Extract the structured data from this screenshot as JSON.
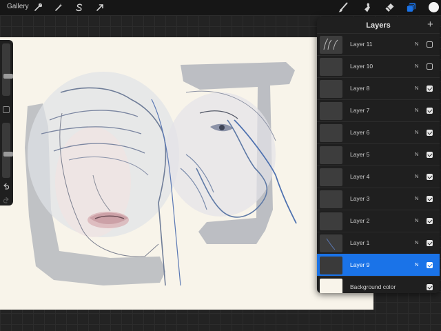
{
  "topbar": {
    "gallery_label": "Gallery",
    "left_tools": [
      "wrench-icon",
      "magic-wand-icon",
      "selection-s-icon",
      "transform-arrow-icon"
    ],
    "right_tools": [
      "brush-icon",
      "smudge-icon",
      "eraser-icon",
      "layers-icon"
    ],
    "active_tool": "layers-icon",
    "current_color": "#f5f5f5",
    "accent_color": "#1a73e8"
  },
  "sidebar": {
    "tools": [
      "brush-size-slider",
      "modify-square",
      "opacity-slider",
      "undo-icon",
      "redo-icon"
    ]
  },
  "layers_panel": {
    "title": "Layers",
    "add_icon": "plus-icon",
    "layers": [
      {
        "name": "Layer 11",
        "blend": "N",
        "visible": false,
        "active": false
      },
      {
        "name": "Layer 10",
        "blend": "N",
        "visible": false,
        "active": false
      },
      {
        "name": "Layer 8",
        "blend": "N",
        "visible": true,
        "active": false
      },
      {
        "name": "Layer 7",
        "blend": "N",
        "visible": true,
        "active": false
      },
      {
        "name": "Layer 6",
        "blend": "N",
        "visible": true,
        "active": false
      },
      {
        "name": "Layer 5",
        "blend": "N",
        "visible": true,
        "active": false
      },
      {
        "name": "Layer 4",
        "blend": "N",
        "visible": true,
        "active": false
      },
      {
        "name": "Layer 3",
        "blend": "N",
        "visible": true,
        "active": false
      },
      {
        "name": "Layer 2",
        "blend": "N",
        "visible": true,
        "active": false
      },
      {
        "name": "Layer 1",
        "blend": "N",
        "visible": true,
        "active": false
      },
      {
        "name": "Layer 9",
        "blend": "N",
        "visible": true,
        "active": true
      },
      {
        "name": "Background color",
        "blend": "",
        "visible": true,
        "active": false
      }
    ]
  }
}
